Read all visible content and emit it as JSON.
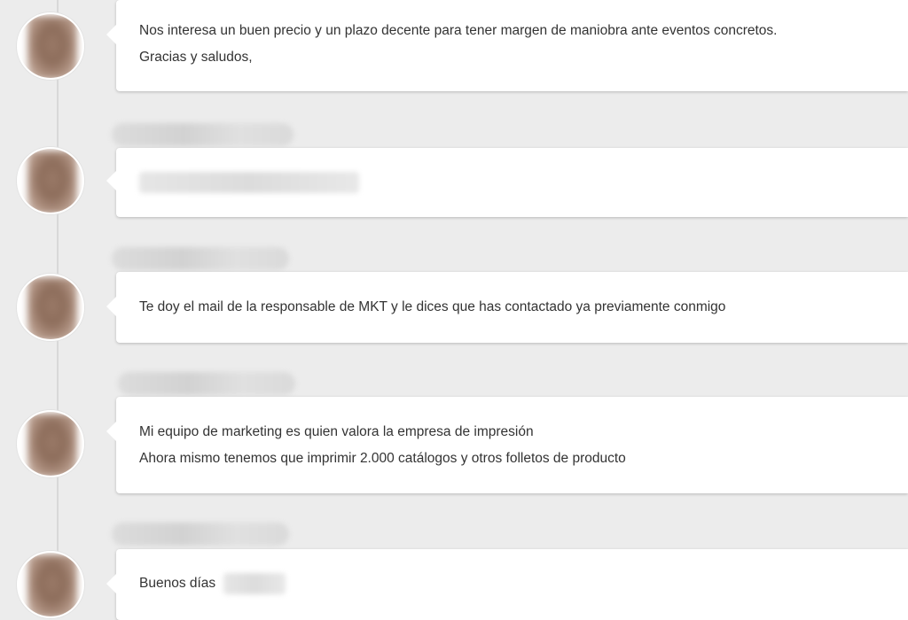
{
  "thread": {
    "messages": [
      {
        "lines": [
          "Nos interesa un buen precio y un plazo decente para tener margen de maniobra ante eventos concretos.",
          "Gracias y saludos,"
        ]
      },
      {
        "lines": []
      },
      {
        "lines": [
          "Te doy el mail de la responsable de MKT y le dices que has contactado ya previamente conmigo"
        ]
      },
      {
        "lines": [
          "Mi equipo de marketing es quien valora la empresa de impresión",
          "Ahora mismo tenemos que imprimir 2.000 catálogos y otros folletos de producto"
        ]
      },
      {
        "lines": [
          "Buenos días"
        ]
      }
    ]
  },
  "colors": {
    "background": "#ececec",
    "bubble": "#ffffff",
    "text": "#333333",
    "timeline": "#d8d8d8"
  }
}
